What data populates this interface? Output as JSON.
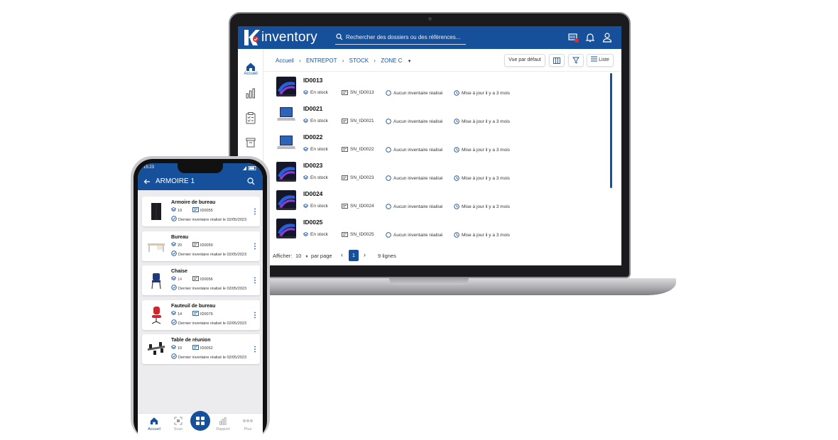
{
  "laptop": {
    "brand": "inventory",
    "search_placeholder": "Rechercher des dossiers ou des références...",
    "sidebar": {
      "home_label": "Accueil"
    },
    "breadcrumb": [
      "Accueil",
      "ENTREPOT",
      "STOCK",
      "ZONE C"
    ],
    "toolbar": {
      "view_default": "Vue par défaut",
      "list_label": "Liste"
    },
    "items": [
      {
        "id": "ID0013",
        "status": "En stock",
        "serial": "SN_ID0013",
        "inventory": "Aucun inventaire réalisé",
        "updated": "Mise à jour il y a 3 mois",
        "thumb": "laptop-dark"
      },
      {
        "id": "ID0021",
        "status": "En stock",
        "serial": "SN_ID0021",
        "inventory": "Aucun inventaire réalisé",
        "updated": "Mise à jour il y a 3 mois",
        "thumb": "laptop-open"
      },
      {
        "id": "ID0022",
        "status": "En stock",
        "serial": "SN_ID0022",
        "inventory": "Aucun inventaire réalisé",
        "updated": "Mise à jour il y a 3 mois",
        "thumb": "laptop-open"
      },
      {
        "id": "ID0023",
        "status": "En stock",
        "serial": "SN_ID0023",
        "inventory": "Aucun inventaire réalisé",
        "updated": "Mise à jour il y a 3 mois",
        "thumb": "laptop-dark"
      },
      {
        "id": "ID0024",
        "status": "En stock",
        "serial": "SN_ID0024",
        "inventory": "Aucun inventaire réalisé",
        "updated": "Mise à jour il y a 3 mois",
        "thumb": "laptop-dark"
      },
      {
        "id": "ID0025",
        "status": "En stock",
        "serial": "SN_ID0025",
        "inventory": "Aucun inventaire réalisé",
        "updated": "Mise à jour il y a 3 mois",
        "thumb": "laptop-dark"
      }
    ],
    "pager": {
      "show_label": "Afficher:",
      "page_size": "10",
      "per_page": "par page",
      "current_page": "1",
      "total": "9 lignes"
    }
  },
  "phone": {
    "time": "15:23",
    "title": "ARMOIRE 1",
    "items": [
      {
        "name": "Armoire de bureau",
        "qty": "19",
        "ref": "ID0055",
        "last": "Dernier inventaire réalisé le 02/05/2023",
        "qty_alert": false
      },
      {
        "name": "Bureau",
        "qty": "20",
        "ref": "ID0059",
        "last": "Dernier inventaire réalisé le 02/05/2023",
        "qty_alert": false
      },
      {
        "name": "Chaise",
        "qty": "14",
        "ref": "ID0056",
        "last": "Dernier inventaire réalisé le 02/05/2023",
        "qty_alert": true
      },
      {
        "name": "Fauteuil de bureau",
        "qty": "14",
        "ref": "ID0079",
        "last": "Dernier inventaire réalisé le 02/05/2023",
        "qty_alert": false
      },
      {
        "name": "Table de réunion",
        "qty": "10",
        "ref": "ID0052",
        "last": "Dernier inventaire réalisé le 02/05/2023",
        "qty_alert": false
      }
    ],
    "nav": [
      "Accueil",
      "Scan",
      "Rapport",
      "Plus"
    ]
  },
  "colors": {
    "brand": "#16509a",
    "alert": "#d9342b"
  }
}
